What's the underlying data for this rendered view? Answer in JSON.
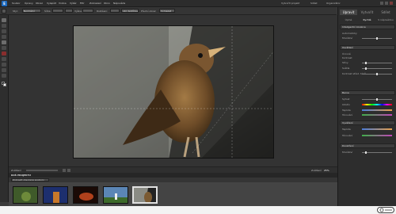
{
  "menubar": {
    "logo": "E",
    "menu": [
      "Soubor",
      "Úpravy",
      "Obraz",
      "Vylepšit",
      "Vrstva",
      "Výběr",
      "Filtr",
      "Zobrazení",
      "Okno",
      "Nápověda"
    ],
    "right": [
      "Vytvořit projekt",
      "Sdílet",
      "Organizátor"
    ]
  },
  "options": {
    "style_label": "Styl:",
    "style_value": "Normální",
    "width_label": "Šířka:",
    "width_value": "",
    "height_label": "Výška:",
    "height_value": "",
    "res_label": "Rozlišení:",
    "res_value": "",
    "units_value": "obr. bodů/palec",
    "front_image": "Přední obraz",
    "clear": "Vymazat"
  },
  "document": {
    "tab": ""
  },
  "status": {
    "zoom_label": "Zvětšení",
    "zoom_right": "Zvětšení",
    "zoom_value": "25%"
  },
  "bin": {
    "title": "KOŠ PROJEKTU",
    "dropdown": "Zobrazit otevřené soubory"
  },
  "panel": {
    "tabs": [
      "Upravit",
      "Vytvořit",
      "Sdílet"
    ],
    "modes": [
      "Úplné",
      "Rychlé",
      "S nápovědou"
    ],
    "sections": [
      {
        "title": "Inteligentní korekce",
        "rows": [
          "Automaticky",
          "Množství"
        ]
      },
      {
        "title": "Osvětlení",
        "rows": [
          "Úrovně",
          "Kontrast",
          "Stíny",
          "Světla",
          "Kontrast střed. tónů"
        ]
      },
      {
        "title": "Barva",
        "rows": [
          "Sytost",
          "Odstín",
          "Teplota",
          "Tónování"
        ]
      },
      {
        "title": "Vyvážení",
        "rows": [
          "Teplota",
          "Tónování"
        ]
      },
      {
        "title": "Doostření",
        "rows": [
          "Množství"
        ]
      }
    ]
  },
  "colors": {
    "accent": "#1f6bbf",
    "panel_bg": "#2d2d2d",
    "canvas_bg": "#333333"
  }
}
